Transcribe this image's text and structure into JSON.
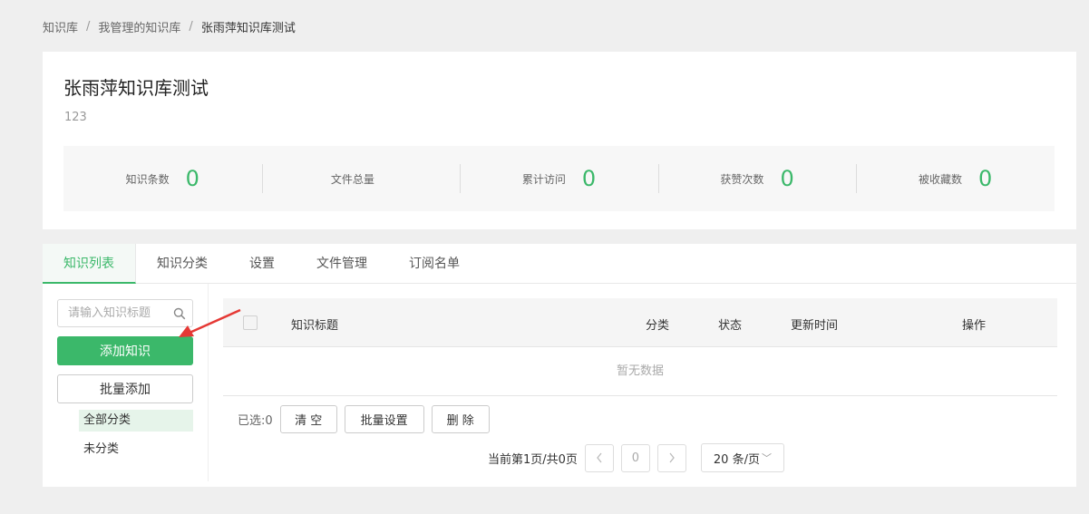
{
  "breadcrumb": {
    "items": [
      "知识库",
      "我管理的知识库"
    ],
    "current": "张雨萍知识库测试",
    "separator": "/"
  },
  "kb": {
    "title": "张雨萍知识库测试",
    "description": "123",
    "stats": [
      {
        "label": "知识条数",
        "value": "0"
      },
      {
        "label": "文件总量",
        "value": ""
      },
      {
        "label": "累计访问",
        "value": "0"
      },
      {
        "label": "获赞次数",
        "value": "0"
      },
      {
        "label": "被收藏数",
        "value": "0"
      }
    ]
  },
  "tabs": [
    {
      "label": "知识列表",
      "active": true
    },
    {
      "label": "知识分类",
      "active": false
    },
    {
      "label": "设置",
      "active": false
    },
    {
      "label": "文件管理",
      "active": false
    },
    {
      "label": "订阅名单",
      "active": false
    }
  ],
  "sidebar": {
    "search_placeholder": "请输入知识标题",
    "search_icon": "search-icon",
    "add_label": "添加知识",
    "batch_add_label": "批量添加",
    "categories": [
      {
        "label": "全部分类",
        "active": true
      },
      {
        "label": "未分类",
        "active": false
      }
    ]
  },
  "table": {
    "columns": {
      "title": "知识标题",
      "category": "分类",
      "status": "状态",
      "updated": "更新时间",
      "operations": "操作"
    },
    "empty_text": "暂无数据"
  },
  "bulk": {
    "selected": "已选:0",
    "clear": "清 空",
    "batch_settings": "批量设置",
    "delete": "删 除"
  },
  "pagination": {
    "info": "当前第1页/共0页",
    "prev_icon": "chevron-left-icon",
    "next_icon": "chevron-right-icon",
    "current_page": "0",
    "page_size": "20 条/页"
  },
  "colors": {
    "accent": "#3bb86a",
    "annotation_arrow": "#e53935"
  }
}
